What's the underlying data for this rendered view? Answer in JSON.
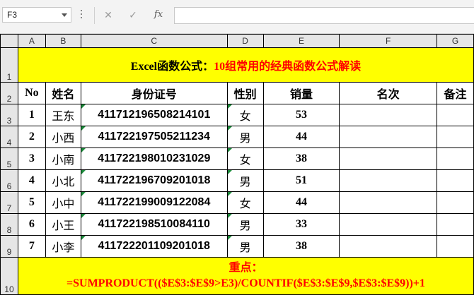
{
  "formula_bar": {
    "name_box": "F3",
    "cancel_icon": "close-icon",
    "enter_icon": "check-icon",
    "fx_label": "fx",
    "formula": ""
  },
  "columns": [
    "A",
    "B",
    "C",
    "D",
    "E",
    "F",
    "G"
  ],
  "rows": [
    "1",
    "2",
    "3",
    "4",
    "5",
    "6",
    "7",
    "8",
    "9",
    "10"
  ],
  "title": {
    "part1": "Excel函数公式：",
    "part2": "10组常用的经典函数公式解读"
  },
  "headers": [
    "No",
    "姓名",
    "身份证号",
    "性别",
    "销量",
    "名次",
    "备注"
  ],
  "data_rows": [
    {
      "no": "1",
      "name": "王东",
      "id": "411712196508214101",
      "gender": "女",
      "sales": "53",
      "rank": "",
      "note": ""
    },
    {
      "no": "2",
      "name": "小西",
      "id": "411722197505211234",
      "gender": "男",
      "sales": "44",
      "rank": "",
      "note": ""
    },
    {
      "no": "3",
      "name": "小南",
      "id": "411722198010231029",
      "gender": "女",
      "sales": "38",
      "rank": "",
      "note": ""
    },
    {
      "no": "4",
      "name": "小北",
      "id": "411722196709201018",
      "gender": "男",
      "sales": "51",
      "rank": "",
      "note": ""
    },
    {
      "no": "5",
      "name": "小中",
      "id": "411722199009122084",
      "gender": "女",
      "sales": "44",
      "rank": "",
      "note": ""
    },
    {
      "no": "6",
      "name": "小王",
      "id": "411722198510084110",
      "gender": "男",
      "sales": "33",
      "rank": "",
      "note": ""
    },
    {
      "no": "7",
      "name": "小李",
      "id": "411722201109201018",
      "gender": "男",
      "sales": "38",
      "rank": "",
      "note": ""
    }
  ],
  "footer": {
    "label": "重点：",
    "formula": "=SUMPRODUCT(($E$3:$E$9>E3)/COUNTIF($E$3:$E$9,$E$3:$E$9))+1"
  },
  "colors": {
    "highlight": "#ffff00",
    "title_accent": "#ff0000",
    "indicator": "#1b8a3a"
  }
}
